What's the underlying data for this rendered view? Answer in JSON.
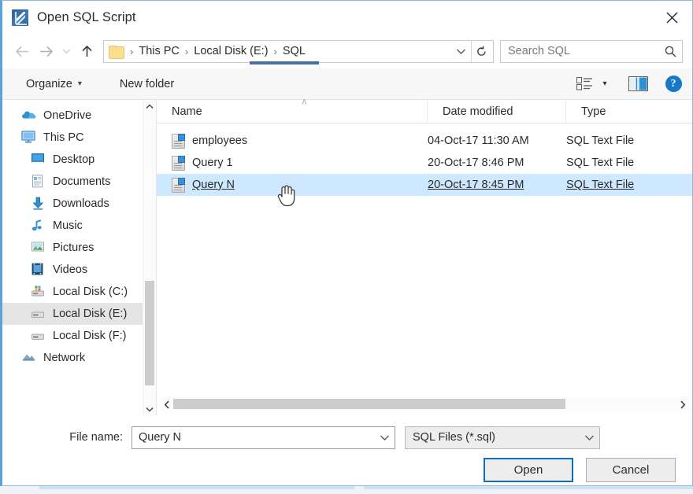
{
  "window": {
    "title": "Open SQL Script",
    "app_icon": "sql-script-icon",
    "close_label": "✕"
  },
  "address_bar": {
    "back_icon": "back-arrow-icon",
    "forward_icon": "forward-arrow-icon",
    "recent_icon": "chevron-down-icon",
    "up_icon": "up-arrow-icon",
    "folder_icon": "folder-icon",
    "separator": "›",
    "crumbs": [
      "This PC",
      "Local Disk (E:)",
      "SQL"
    ],
    "dropdown_icon": "chevron-down-icon",
    "refresh_icon": "refresh-icon",
    "search": {
      "placeholder": "Search SQL",
      "value": "",
      "icon": "search-icon"
    }
  },
  "command_bar": {
    "organize_label": "Organize",
    "organize_caret": "▾",
    "new_folder_label": "New folder",
    "view_icon": "view-options-icon",
    "view_caret": "▾",
    "preview_pane_icon": "preview-pane-icon",
    "help_icon": "help-icon",
    "help_glyph": "?"
  },
  "sidebar": {
    "scroll_up_icon": "chevron-up-icon",
    "scroll_down_icon": "chevron-down-icon",
    "items": [
      {
        "label": "OneDrive",
        "icon": "onedrive-cloud-icon",
        "indent": false,
        "selected": false
      },
      {
        "label": "This PC",
        "icon": "this-pc-monitor-icon",
        "indent": false,
        "selected": false
      },
      {
        "label": "Desktop",
        "icon": "desktop-icon",
        "indent": true,
        "selected": false
      },
      {
        "label": "Documents",
        "icon": "documents-icon",
        "indent": true,
        "selected": false
      },
      {
        "label": "Downloads",
        "icon": "downloads-arrow-icon",
        "indent": true,
        "selected": false
      },
      {
        "label": "Music",
        "icon": "music-note-icon",
        "indent": true,
        "selected": false
      },
      {
        "label": "Pictures",
        "icon": "pictures-icon",
        "indent": true,
        "selected": false
      },
      {
        "label": "Videos",
        "icon": "videos-icon",
        "indent": true,
        "selected": false
      },
      {
        "label": "Local Disk (C:)",
        "icon": "system-drive-icon",
        "indent": true,
        "selected": false
      },
      {
        "label": "Local Disk (E:)",
        "icon": "drive-icon",
        "indent": true,
        "selected": true
      },
      {
        "label": "Local Disk (F:)",
        "icon": "drive-icon",
        "indent": true,
        "selected": false
      },
      {
        "label": "Network",
        "icon": "network-icon",
        "indent": false,
        "selected": false
      }
    ]
  },
  "file_list": {
    "columns": [
      "Name",
      "Date modified",
      "Type"
    ],
    "sort_indicator": "∧",
    "rows": [
      {
        "name": "employees",
        "date": "04-Oct-17 11:30 AM",
        "type": "SQL Text File",
        "selected": false
      },
      {
        "name": "Query 1",
        "date": "20-Oct-17 8:46 PM",
        "type": "SQL Text File",
        "selected": false
      },
      {
        "name": "Query N",
        "date": "20-Oct-17 8:45 PM",
        "type": "SQL Text File",
        "selected": true
      }
    ],
    "hscroll_left_icon": "chevron-left-icon",
    "hscroll_right_icon": "chevron-right-icon"
  },
  "footer": {
    "file_name_label": "File name:",
    "file_name_value": "Query N",
    "file_name_caret": "∨",
    "filter_value": "SQL Files (*.sql)",
    "filter_caret": "∨",
    "open_label": "Open",
    "cancel_label": "Cancel"
  },
  "colors": {
    "accent": "#0d6ebf",
    "selection": "#cde8ff",
    "sidebar_selection": "#e4e4e4",
    "window_border": "#5ca3dd",
    "help_blue": "#1878c8"
  }
}
